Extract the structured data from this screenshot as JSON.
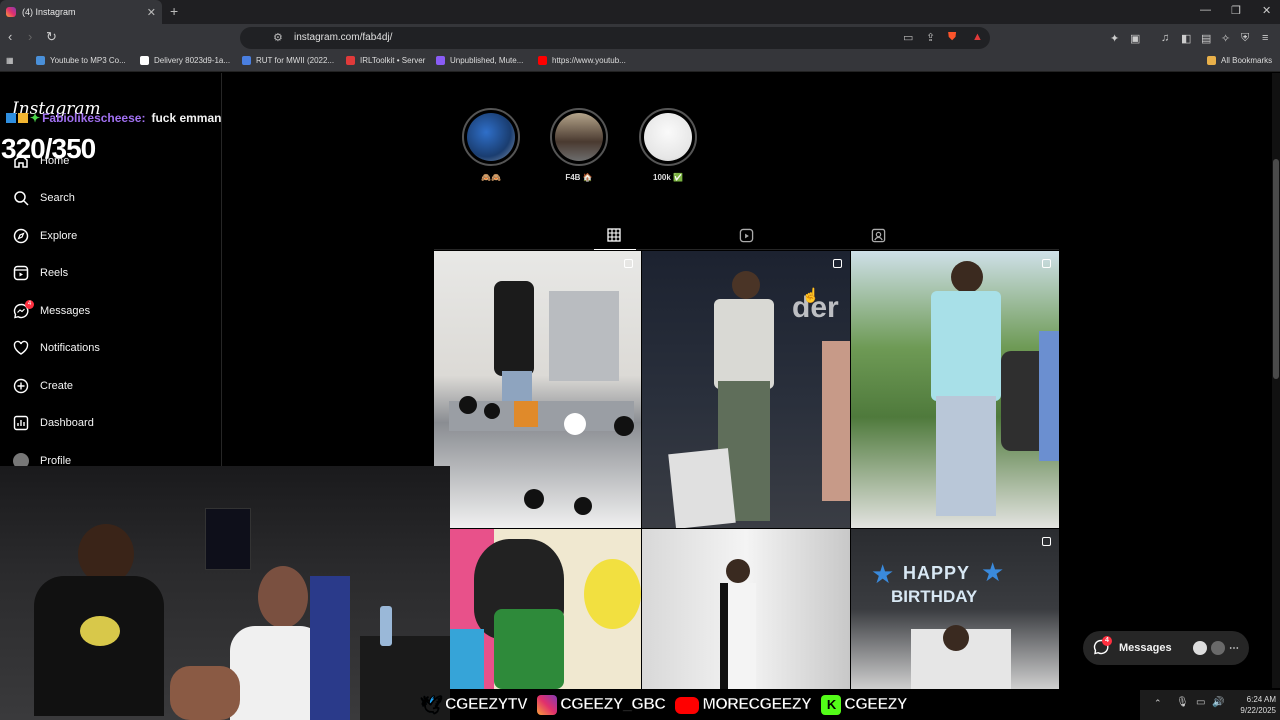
{
  "browser": {
    "tab_title": "(4) Instagram",
    "tab_close": "✕",
    "new_tab": "+",
    "url": "instagram.com/fab4dj/",
    "bookmarks": [
      {
        "label": "Youtube to MP3 Co...",
        "color": "#4a90d9"
      },
      {
        "label": "Delivery 8023d9-1a...",
        "color": "#ffffff"
      },
      {
        "label": "RUT for MWII (2022...",
        "color": "#4a7fe0"
      },
      {
        "label": "IRLToolkit • Server",
        "color": "#e03a3a"
      },
      {
        "label": "Unpublished, Mute...",
        "color": "#8a5cf6"
      },
      {
        "label": "https://www.youtub...",
        "color": "#ff0000"
      }
    ],
    "all_bookmarks": "All Bookmarks"
  },
  "sidebar": {
    "logo": "Instagram",
    "items": [
      {
        "label": "Home",
        "icon": "home-icon"
      },
      {
        "label": "Search",
        "icon": "search-icon"
      },
      {
        "label": "Explore",
        "icon": "compass-icon"
      },
      {
        "label": "Reels",
        "icon": "reels-icon"
      },
      {
        "label": "Messages",
        "icon": "messenger-icon",
        "badge": "4"
      },
      {
        "label": "Notifications",
        "icon": "heart-icon"
      },
      {
        "label": "Create",
        "icon": "plus-icon"
      },
      {
        "label": "Dashboard",
        "icon": "dashboard-icon"
      },
      {
        "label": "Profile",
        "icon": "avatar-icon"
      }
    ]
  },
  "stories": [
    {
      "label": "🙈🙈"
    },
    {
      "label": "F4B 🏠"
    },
    {
      "label": "100k ✅"
    }
  ],
  "floating_messages": {
    "label": "Messages",
    "badge": "4"
  },
  "overlay": {
    "chat_user": "Fabiolikescheese:",
    "chat_message": "fuck emman",
    "counter": "320/350"
  },
  "socials": [
    {
      "handle": "CGEEZYTV",
      "icon": "twitter-icon",
      "color": "#1da1f2"
    },
    {
      "handle": "CGEEZY_GBC",
      "icon": "instagram-icon",
      "color": "#e1306c"
    },
    {
      "handle": "MORECGEEZY",
      "icon": "youtube-icon",
      "color": "#ff0000"
    },
    {
      "handle": "CGEEZY",
      "icon": "kick-icon",
      "color": "#53fc18"
    }
  ],
  "taskbar": {
    "time": "6:24 AM",
    "date": "9/22/2025"
  }
}
